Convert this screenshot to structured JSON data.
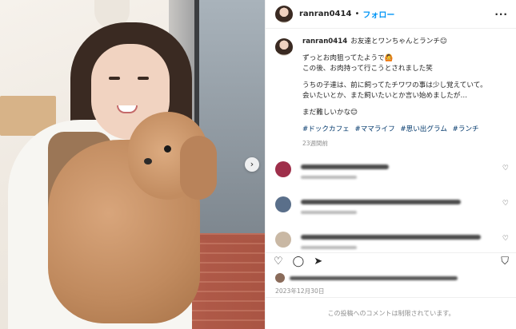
{
  "post": {
    "username": "ranran0414",
    "separator": "•",
    "follow_label": "フォロー",
    "more_label": "···",
    "next_label": "›"
  },
  "caption": {
    "username": "ranran0414",
    "first_line": "お友達とワンちゃんとランチ☺",
    "lines_a": [
      "ずっとお肉狙ってたようで🙆",
      "この後、お肉持って行こうとされました笑"
    ],
    "lines_b": [
      "うちの子達は、前に飼ってたチワワの事は少し覚えていて。",
      "会いたいとか、また飼いたいとか言い始めましたが…"
    ],
    "lines_c": [
      "まだ難しいかな😊"
    ],
    "hashtags": [
      "#ドックカフェ",
      "#ママライフ",
      "#思い出グラム",
      "#ランチ"
    ],
    "time": "23週間前"
  },
  "comments": [
    {
      "avatar_color": "#9e2f4a",
      "text_width": 110
    },
    {
      "avatar_color": "#5a6f8a",
      "text_width": 200
    },
    {
      "avatar_color": "#c9b8a4",
      "text_width": 225
    }
  ],
  "actions": {
    "like_icon": "heart-icon",
    "comment_icon": "comment-icon",
    "share_icon": "share-icon",
    "save_icon": "bookmark-icon",
    "like_glyph": "♡",
    "comment_glyph": "◯",
    "share_glyph": "➤",
    "save_glyph": "⛉"
  },
  "date": "2023年12月30日",
  "comments_disabled": "この投稿へのコメントは制限されています。",
  "colors": {
    "accent": "#0095f6",
    "hashtag": "#00376b",
    "muted": "#8e8e8e"
  }
}
